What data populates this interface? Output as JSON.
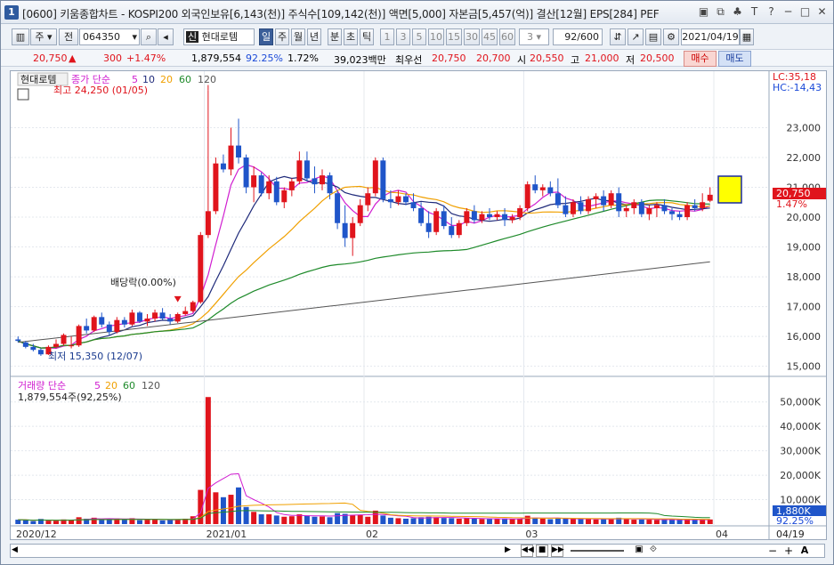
{
  "window": {
    "number": "1",
    "title": "[0600] 키움종합차트 - KOSPI200 외국인보유[6,143(천)] 주식수[109,142(천)] 액면[5,000] 자본금[5,457(억)] 결산[12월] EPS[284] PEF",
    "buttons": [
      "▣",
      "⧉",
      "♣",
      "T",
      "?",
      "─",
      "□",
      "✕"
    ]
  },
  "toolbar": {
    "period_label": "주",
    "type_label": "전",
    "code": "064350",
    "stock_name": "현대로템",
    "name_badge": "신",
    "periods": [
      "일",
      "주",
      "월",
      "년",
      "분",
      "초",
      "틱"
    ],
    "active_period": "일",
    "intervals": [
      "1",
      "3",
      "5",
      "10",
      "15",
      "30",
      "45",
      "60"
    ],
    "interval_select": "3",
    "count": "92/600",
    "date": "2021/04/19"
  },
  "quote": {
    "price": "20,750",
    "arrow": "▲",
    "change": "300",
    "change_pct": "+1.47%",
    "volume": "1,879,554",
    "vol_ratio": "92.25%",
    "turnover": "1.72%",
    "amount": "39,023백만",
    "pref_label": "최우선",
    "ask": "20,750",
    "bid": "20,700",
    "open_label": "시",
    "open": "20,550",
    "high_label": "고",
    "high": "21,000",
    "low_label": "저",
    "low": "20,500",
    "buy_label": "매수",
    "sell_label": "매도"
  },
  "price_panel": {
    "legend_name": "현대로템",
    "legend_ma": "종가 단순",
    "ma_periods": [
      "5",
      "10",
      "20",
      "60",
      "120"
    ],
    "ma_colors": [
      "#d01ed0",
      "#1f2a7a",
      "#f0a000",
      "#1e8a2a",
      "#555555"
    ],
    "lc": "LC:35,18",
    "hc": "HC:-14,43",
    "high_note": "최고 24,250 (01/05)",
    "low_note": "최저 15,350 (12/07)",
    "dividend_note": "배당락(0.00%)",
    "last_price": "20,750",
    "last_pct": "1.47%",
    "y_ticks": [
      "23,000",
      "22,000",
      "21,000",
      "20,000",
      "19,000",
      "18,000",
      "17,000",
      "16,000",
      "15,000"
    ]
  },
  "volume_panel": {
    "legend": "거래량 단순",
    "ma_periods": [
      "5",
      "20",
      "60",
      "120"
    ],
    "current": "1,879,554주(92,25%)",
    "last_value": "1,880K",
    "last_pct": "92.25%",
    "y_ticks": [
      "50,000K",
      "40,000K",
      "30,000K",
      "20,000K",
      "10,000K"
    ]
  },
  "x_axis": [
    "2020/12",
    "2021/01",
    "02",
    "03",
    "04"
  ],
  "x_axis_right": "04/19",
  "colors": {
    "up": "#e0141c",
    "down": "#1f55c9",
    "accent": "#3b5e99"
  },
  "chart_data": {
    "type": "candlestick",
    "title": "",
    "ylim": [
      15000,
      24250
    ],
    "candles": [
      [
        15900,
        16000,
        15800,
        15850
      ],
      [
        15800,
        15850,
        15600,
        15650
      ],
      [
        15650,
        15750,
        15500,
        15550
      ],
      [
        15550,
        15600,
        15350,
        15400
      ],
      [
        15400,
        15700,
        15380,
        15650
      ],
      [
        15650,
        15900,
        15600,
        15750
      ],
      [
        15750,
        16100,
        15700,
        16050
      ],
      [
        15700,
        16000,
        15600,
        15700
      ],
      [
        15700,
        16400,
        15650,
        16350
      ],
      [
        16350,
        16600,
        16100,
        16200
      ],
      [
        16200,
        16700,
        16150,
        16650
      ],
      [
        16650,
        16800,
        16300,
        16400
      ],
      [
        16400,
        16500,
        16050,
        16150
      ],
      [
        16150,
        16650,
        16100,
        16550
      ],
      [
        16550,
        16650,
        16300,
        16400
      ],
      [
        16400,
        16900,
        16350,
        16800
      ],
      [
        16800,
        16850,
        16450,
        16500
      ],
      [
        16500,
        16750,
        16350,
        16600
      ],
      [
        16600,
        16900,
        16500,
        16800
      ],
      [
        16800,
        16950,
        16550,
        16600
      ],
      [
        16600,
        16750,
        16400,
        16500
      ],
      [
        16500,
        16800,
        16450,
        16750
      ],
      [
        16750,
        17000,
        16700,
        16850
      ],
      [
        16850,
        17200,
        16800,
        17150
      ],
      [
        17150,
        19500,
        17100,
        19400
      ],
      [
        19400,
        24250,
        19300,
        20200
      ],
      [
        20200,
        22000,
        20100,
        21800
      ],
      [
        21800,
        22100,
        21500,
        21600
      ],
      [
        21600,
        23000,
        21400,
        22400
      ],
      [
        22400,
        23300,
        21800,
        22000
      ],
      [
        22000,
        22100,
        20800,
        21000
      ],
      [
        21000,
        21700,
        20500,
        21400
      ],
      [
        21400,
        21500,
        20700,
        20800
      ],
      [
        20800,
        21400,
        20600,
        21200
      ],
      [
        21200,
        21350,
        20400,
        20500
      ],
      [
        20500,
        21000,
        20300,
        20900
      ],
      [
        20900,
        21300,
        20700,
        21200
      ],
      [
        21200,
        22200,
        21100,
        21900
      ],
      [
        21900,
        22200,
        21200,
        21300
      ],
      [
        21300,
        21700,
        20800,
        21100
      ],
      [
        21100,
        21600,
        20900,
        21400
      ],
      [
        21400,
        21500,
        20600,
        20800
      ],
      [
        20800,
        20900,
        19600,
        19800
      ],
      [
        19800,
        20400,
        19000,
        19300
      ],
      [
        19300,
        20000,
        18700,
        19800
      ],
      [
        19800,
        20600,
        19700,
        20400
      ],
      [
        20400,
        21000,
        20200,
        20800
      ],
      [
        20800,
        22000,
        20700,
        21900
      ],
      [
        21900,
        22000,
        20500,
        20600
      ],
      [
        20600,
        20900,
        20300,
        20500
      ],
      [
        20500,
        20900,
        20400,
        20700
      ],
      [
        20700,
        20800,
        20400,
        20500
      ],
      [
        20500,
        20800,
        20200,
        20300
      ],
      [
        20300,
        20500,
        19700,
        19800
      ],
      [
        19800,
        20200,
        19300,
        19500
      ],
      [
        19500,
        20300,
        19400,
        20200
      ],
      [
        20200,
        20400,
        19600,
        19700
      ],
      [
        19700,
        20000,
        19300,
        19400
      ],
      [
        19400,
        19900,
        19300,
        19800
      ],
      [
        19800,
        20300,
        19700,
        20200
      ],
      [
        20200,
        20400,
        19800,
        19900
      ],
      [
        19900,
        20200,
        19800,
        20100
      ],
      [
        20100,
        20300,
        19900,
        20000
      ],
      [
        20000,
        20200,
        19900,
        20100
      ],
      [
        20100,
        20300,
        19700,
        19900
      ],
      [
        19900,
        20100,
        19800,
        20000
      ],
      [
        20000,
        20400,
        19900,
        20300
      ],
      [
        20300,
        21200,
        20200,
        21100
      ],
      [
        21100,
        21400,
        20800,
        20900
      ],
      [
        20900,
        21100,
        20700,
        21000
      ],
      [
        21000,
        21200,
        20700,
        20800
      ],
      [
        20800,
        21300,
        20300,
        20400
      ],
      [
        20400,
        20700,
        20000,
        20100
      ],
      [
        20100,
        20600,
        20000,
        20500
      ],
      [
        20500,
        20700,
        20100,
        20200
      ],
      [
        20200,
        20700,
        20100,
        20600
      ],
      [
        20600,
        20800,
        20300,
        20700
      ],
      [
        20700,
        20900,
        20200,
        20400
      ],
      [
        20400,
        20900,
        20300,
        20800
      ],
      [
        20800,
        21000,
        20000,
        20200
      ],
      [
        20200,
        20400,
        20000,
        20300
      ],
      [
        20300,
        20600,
        20100,
        20500
      ],
      [
        20500,
        20600,
        20000,
        20100
      ],
      [
        20100,
        20400,
        19900,
        20300
      ],
      [
        20300,
        20500,
        20000,
        20400
      ],
      [
        20400,
        20600,
        20100,
        20200
      ],
      [
        20200,
        20300,
        19900,
        20100
      ],
      [
        20100,
        20200,
        19900,
        20000
      ],
      [
        20000,
        20500,
        19900,
        20400
      ],
      [
        20400,
        20600,
        20200,
        20300
      ],
      [
        20300,
        20800,
        20200,
        20500
      ],
      [
        20550,
        21000,
        20500,
        20750
      ]
    ],
    "volumes": [
      1.8,
      1.6,
      1.2,
      2.1,
      1.4,
      1.3,
      1.9,
      1.5,
      2.8,
      2.2,
      2.6,
      1.7,
      1.9,
      2.3,
      2.0,
      2.4,
      1.6,
      1.8,
      2.0,
      1.5,
      1.7,
      1.9,
      2.2,
      3.2,
      14,
      52,
      13,
      11,
      12,
      15,
      7,
      5,
      4,
      4,
      3.5,
      3,
      3.2,
      4,
      3.5,
      3,
      3.1,
      2.8,
      4.5,
      4.2,
      3.6,
      3.8,
      3,
      5.5,
      3.5,
      2.6,
      2.4,
      2.2,
      2.4,
      2.8,
      3,
      2.8,
      2.5,
      2.4,
      2.2,
      2.5,
      2.2,
      2.1,
      2.0,
      2.1,
      2.3,
      2.0,
      2.2,
      3.4,
      2.6,
      2.2,
      2.0,
      2.4,
      2.3,
      2.1,
      2.0,
      2.1,
      1.9,
      2.2,
      2.0,
      2.6,
      2.0,
      1.8,
      1.9,
      1.8,
      1.7,
      1.9,
      1.8,
      1.7,
      1.8,
      1.9,
      1.7,
      1.88
    ],
    "volume_unit": "M shares"
  }
}
